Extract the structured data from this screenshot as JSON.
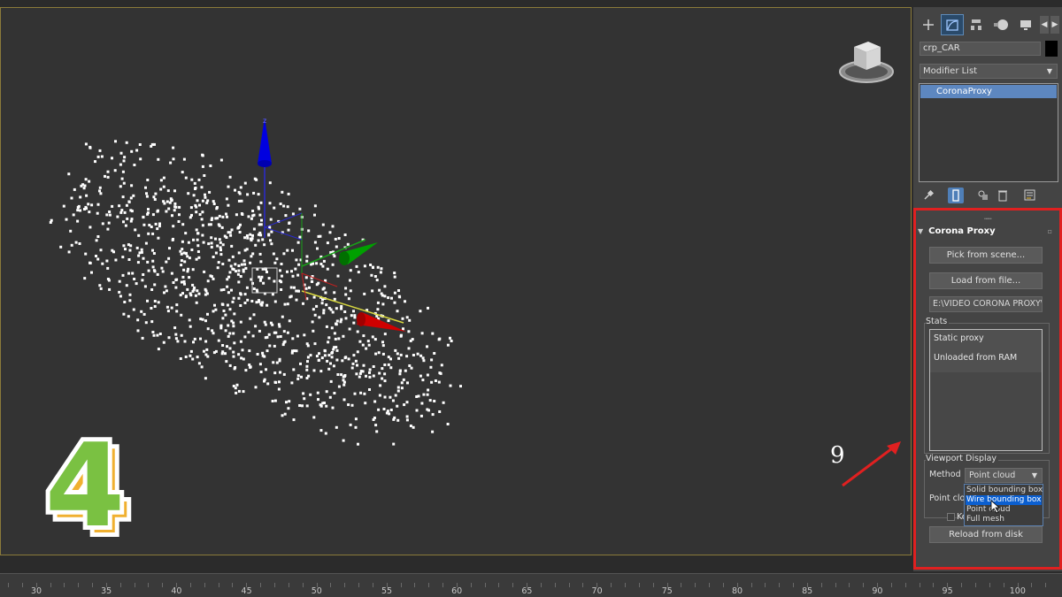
{
  "viewport": {
    "label": "4",
    "gizmo_axis_label": "z",
    "colors": {
      "background": "#333333",
      "points": "#ffffff",
      "axis_z": "#0000e0",
      "axis_y": "#00a000",
      "axis_x": "#d00000",
      "sticker_fill": "#7ac142",
      "sticker_shadow": "#f0b030"
    }
  },
  "annotation": {
    "step_number": "9",
    "arrow_color": "#e02020"
  },
  "command_panel": {
    "tabs": [
      {
        "icon": "create-plus-icon"
      },
      {
        "icon": "modify-icon"
      },
      {
        "icon": "hierarchy-icon"
      },
      {
        "icon": "motion-icon"
      },
      {
        "icon": "display-icon"
      }
    ],
    "object_name": "crp_CAR",
    "object_color": "#000000",
    "modifier_list_label": "Modifier List",
    "modifier_stack": [
      "CoronaProxy"
    ],
    "stack_tools": [
      "pin-stack-icon",
      "show-end-result-icon",
      "make-unique-icon",
      "remove-modifier-icon",
      "configure-modifier-sets-icon"
    ],
    "rollout": {
      "title": "Corona Proxy",
      "pick_button": "Pick from scene...",
      "load_button": "Load from file...",
      "file_path": "E:\\VIDEO CORONA PROXY\\M",
      "stats_label": "Stats",
      "stats_lines": [
        "Static proxy",
        "Unloaded from RAM"
      ],
      "viewport_display_label": "Viewport Display",
      "method_label": "Method",
      "method_value": "Point cloud",
      "method_options": [
        "Solid bounding box",
        "Wire bounding box",
        "Point cloud",
        "Full mesh"
      ],
      "highlighted_option": "Wire bounding box",
      "point_cloud_label": "Point clou",
      "keep_label": "Ke",
      "reload_button": "Reload from disk"
    }
  },
  "timeline": {
    "ticks": [
      "30",
      "35",
      "40",
      "45",
      "50",
      "55",
      "60",
      "65",
      "70",
      "75",
      "80",
      "85",
      "90",
      "95",
      "100"
    ]
  }
}
